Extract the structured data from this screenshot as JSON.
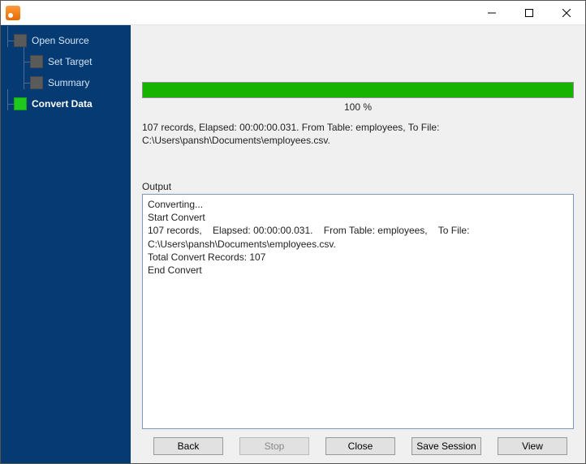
{
  "sidebar": {
    "items": [
      {
        "label": "Open Source",
        "active": false
      },
      {
        "label": "Set Target",
        "active": false
      },
      {
        "label": "Summary",
        "active": false
      },
      {
        "label": "Convert Data",
        "active": true
      }
    ]
  },
  "progress": {
    "percent": 100,
    "label": "100 %"
  },
  "status": "107 records,    Elapsed: 00:00:00.031.    From Table: employees,    To File: C:\\Users\\pansh\\Documents\\employees.csv.",
  "output": {
    "label": "Output",
    "text": "Converting...\nStart Convert\n107 records,    Elapsed: 00:00:00.031.    From Table: employees,    To File: C:\\Users\\pansh\\Documents\\employees.csv.\nTotal Convert Records: 107\nEnd Convert\n"
  },
  "buttons": {
    "back": "Back",
    "stop": "Stop",
    "close": "Close",
    "save_session": "Save Session",
    "view": "View"
  }
}
